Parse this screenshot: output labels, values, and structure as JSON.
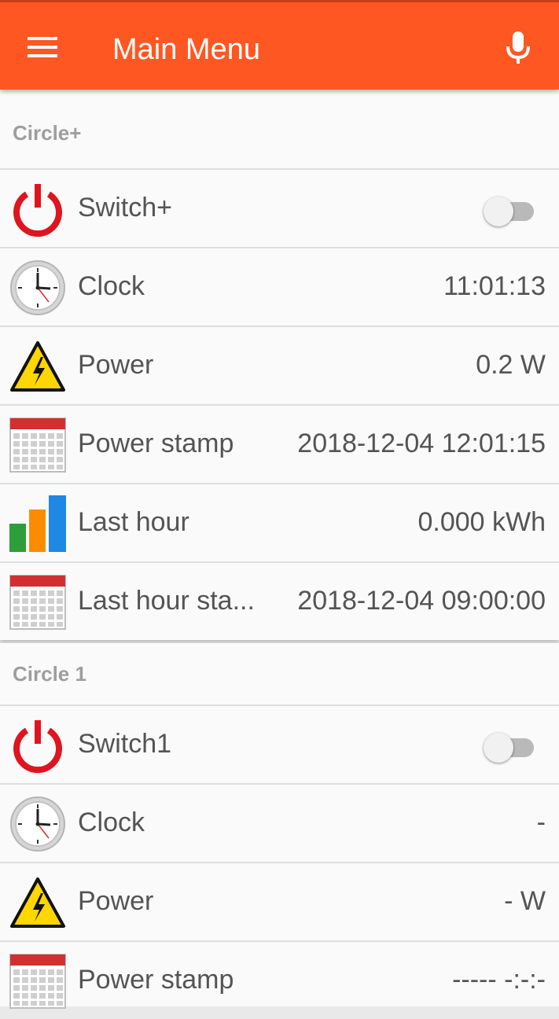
{
  "appbar": {
    "title": "Main Menu",
    "menu_icon": "hamburger-menu-icon",
    "mic_icon": "microphone-icon",
    "color": "#ff5722"
  },
  "sections": [
    {
      "title": "Circle+",
      "rows": [
        {
          "icon": "power-icon",
          "label": "Switch+",
          "type": "switch",
          "value": "off"
        },
        {
          "icon": "clock-icon",
          "label": "Clock",
          "type": "value",
          "value": "11:01:13"
        },
        {
          "icon": "warning-voltage-icon",
          "label": "Power",
          "type": "value",
          "value": "0.2 W"
        },
        {
          "icon": "calendar-icon",
          "label": "Power stamp",
          "type": "value",
          "value": "2018-12-04 12:01:15"
        },
        {
          "icon": "bar-chart-icon",
          "label": "Last hour",
          "type": "value",
          "value": "0.000 kWh"
        },
        {
          "icon": "calendar-icon",
          "label": "Last hour sta...",
          "type": "value",
          "value": "2018-12-04 09:00:00"
        }
      ]
    },
    {
      "title": "Circle 1",
      "rows": [
        {
          "icon": "power-icon",
          "label": "Switch1",
          "type": "switch",
          "value": "off"
        },
        {
          "icon": "clock-icon",
          "label": "Clock",
          "type": "value",
          "value": "-"
        },
        {
          "icon": "warning-voltage-icon",
          "label": "Power",
          "type": "value",
          "value": "- W"
        },
        {
          "icon": "calendar-icon",
          "label": "Power stamp",
          "type": "value",
          "value": "----- -:-:-"
        }
      ]
    }
  ]
}
